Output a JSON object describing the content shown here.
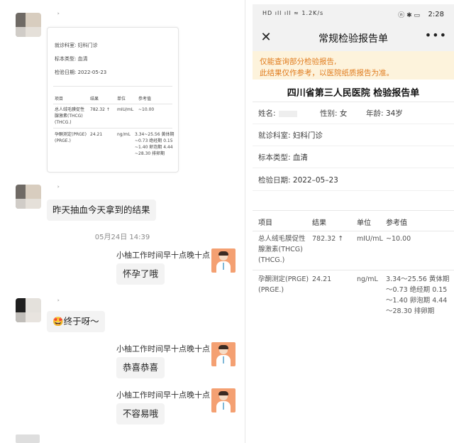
{
  "chat": {
    "report_thumbnail": {
      "fields": [
        "就诊科室:  妇科门诊",
        "标本类型:  血清",
        "检验日期:  2022-05-23"
      ],
      "headers": [
        "项目",
        "结果",
        "单位",
        "参考值"
      ],
      "row1": {
        "name_l1": "总人绒毛膜促性",
        "name_l2": "腺激素(THCG)",
        "name_l3": "(THCG.)",
        "result": "782.32 ↑",
        "unit": "mIU/mL",
        "ref": "~10.00"
      },
      "row2": {
        "name_l1": "孕酮测定(PRGE)",
        "name_l2": "(PRGE.)",
        "result": "24.21",
        "unit": "ng/mL",
        "ref_l1": "3.34~25.56 黄体期",
        "ref_l2": "~0.73 绝经期 0.15",
        "ref_l3": "~1.40 卵泡期 4.44",
        "ref_l4": "~28.30 排卵期"
      }
    },
    "msg_patient_1": "昨天抽血今天拿到的结果",
    "timestamp": "05月24日 14:39",
    "doctor_name": "小柚工作时间早十点晚十点",
    "msg_doctor_1": "怀孕了哦",
    "msg_patient_2": "🤩终于呀～",
    "msg_doctor_2": "恭喜恭喜",
    "msg_doctor_3": "不容易哦"
  },
  "phone": {
    "status": {
      "left": "HD ıll ıll ≈ 1.2K/s",
      "icons": "ⓝ ✱ ▭",
      "time": "2:28"
    },
    "title": "常规检验报告单",
    "notice_l1": "仅能查询部分检验报告,",
    "notice_l2": "此结果仅作参考，以医院纸质报告为准。",
    "hospital": "四川省第三人民医院 检验报告单",
    "name_label": "姓名:",
    "gender_label": "性别:",
    "gender_value": "女",
    "age_label": "年龄:",
    "age_value": "34岁",
    "dept_label": "就诊科室:",
    "dept_value": "妇科门诊",
    "specimen_label": "标本类型:",
    "specimen_value": "血清",
    "date_label": "检验日期:",
    "date_value": "2022–05–23",
    "table": {
      "headers": {
        "item": "项目",
        "result": "结果",
        "unit": "单位",
        "ref": "参考值"
      },
      "row1": {
        "item_l1": "总人绒毛膜促性",
        "item_l2": "腺激素(THCG)",
        "item_l3": "(THCG.)",
        "result": "782.32 ↑",
        "unit": "mIU/mL",
        "ref": "~10.00"
      },
      "row2": {
        "item_l1": "孕酮测定(PRGE)",
        "item_l2": "(PRGE.)",
        "result": "24.21",
        "unit": "ng/mL",
        "ref_l1": "3.34～25.56 黄体期",
        "ref_l2": "～0.73 绝经期 0.15",
        "ref_l3": "～1.40 卵泡期 4.44",
        "ref_l4": "～28.30 排卵期"
      }
    }
  }
}
